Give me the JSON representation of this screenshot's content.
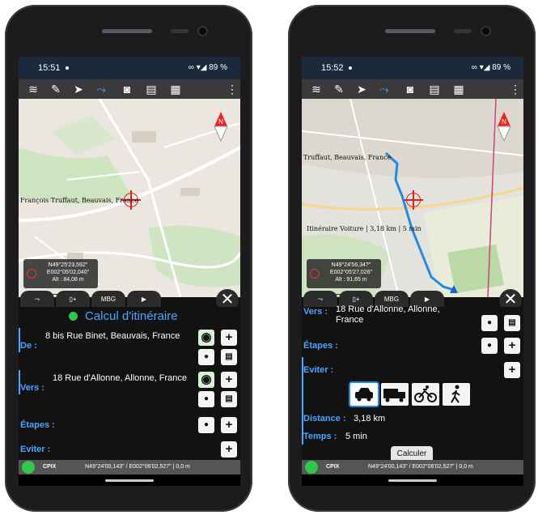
{
  "left": {
    "status": {
      "time": "15:51",
      "battery": "89 %"
    },
    "map": {
      "place_label": "François Truffaut, Beauvais, France",
      "coords": {
        "lat": "N49°25'23,592\"",
        "lon": "E002°05'02,040\"",
        "alt": "Alt : 84,08 m"
      },
      "compass": "N"
    },
    "panel": {
      "title": "Calcul d'itinéraire",
      "from_label": "De :",
      "from_value": "8 bis Rue Binet, Beauvais, France",
      "to_label": "Vers :",
      "to_value": "18 Rue d'Allonne, Allonne, France",
      "steps_label": "Étapes :",
      "avoid_label": "Eviter :"
    },
    "bottombar": {
      "brand": "CPIX",
      "coords": "N49°24'00,143\" / E002°06'02,527\" | 0,0 m"
    }
  },
  "right": {
    "status": {
      "time": "15:52",
      "battery": "89 %"
    },
    "map": {
      "place_label": "Truffaut, Beauvais, France",
      "route_label": "Itinéraire Voiture | 3,18 km | 5 min",
      "coords": {
        "lat": "N49°24'56,34?\"",
        "lon": "E002°05'27,026\"",
        "alt": "Alt : 91,65 m"
      },
      "compass": "N"
    },
    "panel": {
      "to_label": "Vers :",
      "to_value": "18 Rue d'Allonne, Allonne, France",
      "steps_label": "Étapes :",
      "avoid_label": "Eviter :",
      "distance_label": "Distance :",
      "distance_value": "3,18 km",
      "time_label": "Temps :",
      "time_value": "5 min",
      "calc_button": "Calculer"
    },
    "bottombar": {
      "brand": "CPIX",
      "coords": "N49°24'00,143\" / E002°06'02,527\" | 0,0 m"
    }
  },
  "icons": {
    "layers": "≋",
    "pencil": "✎",
    "pointer": "➤",
    "route": "⤳",
    "camera": "◙",
    "mapbook": "▦",
    "grid": "▦",
    "menu": "⋮",
    "plus": "+",
    "pin": "●",
    "map": "▤",
    "car": "🚗",
    "truck": "▬",
    "bike": "⚲",
    "walk": "🚶"
  },
  "tabs": [
    "route",
    "gps-add",
    "mbg",
    "video"
  ],
  "colors": {
    "accent": "#4aa6ff",
    "route": "#1e8ce6",
    "green": "#2ec94a"
  }
}
